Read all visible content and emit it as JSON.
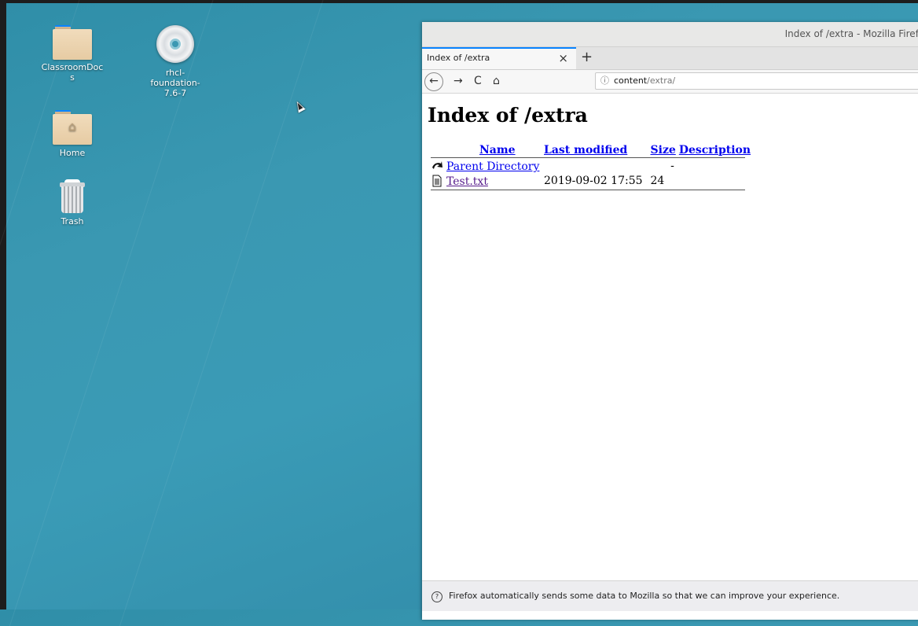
{
  "desktop": {
    "icons": [
      {
        "label": "ClassroomDoc\ns",
        "icon": "folder-icon"
      },
      {
        "label": "rhcl-\nfoundation-\n7.6-7",
        "icon": "disc-icon"
      },
      {
        "label": "Home",
        "icon": "home-folder-icon"
      },
      {
        "label": "Trash",
        "icon": "trash-icon"
      }
    ]
  },
  "browser": {
    "window_title": "Index of /extra - Mozilla Firefox",
    "tab_title": "Index of /extra",
    "tab_close": "×",
    "new_tab": "+",
    "nav": {
      "back": "←",
      "forward": "→",
      "reload": "C",
      "home": "⌂"
    },
    "url": {
      "info": "ⓘ",
      "host": "content",
      "path": "/extra/"
    },
    "notification": "Firefox automatically sends some data to Mozilla so that we can improve your experience."
  },
  "page": {
    "heading": "Index of /extra",
    "columns": [
      "Name",
      "Last modified",
      "Size",
      "Description"
    ],
    "rows": [
      {
        "name": "Parent Directory",
        "modified": "",
        "size": "-",
        "description": "",
        "icon": "back-arrow-icon"
      },
      {
        "name": "Test.txt",
        "modified": "2019-09-02 17:55",
        "size": "24",
        "description": "",
        "icon": "text-file-icon"
      }
    ]
  }
}
